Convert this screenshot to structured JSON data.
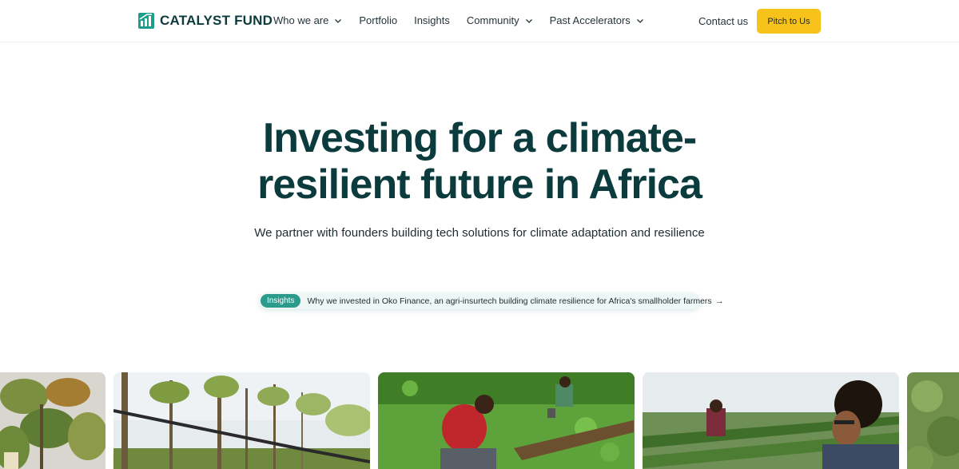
{
  "brand": {
    "name": "CATALYST FUND"
  },
  "nav": {
    "items": [
      {
        "label": "Who we are",
        "has_dropdown": true
      },
      {
        "label": "Portfolio",
        "has_dropdown": false
      },
      {
        "label": "Insights",
        "has_dropdown": false
      },
      {
        "label": "Community",
        "has_dropdown": true
      },
      {
        "label": "Past Accelerators",
        "has_dropdown": true
      }
    ],
    "contact_label": "Contact us",
    "cta_label": "Pitch to Us"
  },
  "hero": {
    "title_line1": "Investing for a climate-",
    "title_line2": "resilient future in Africa",
    "subtitle": "We partner with founders building tech solutions for climate adaptation and resilience"
  },
  "insight_pill": {
    "tag": "Insights",
    "text": "Why we invested in Oko Finance, an agri-insurtech building climate resilience for Africa's smallholder farmers",
    "arrow": "→"
  },
  "gallery": {
    "images": [
      {
        "name": "tree-leaves-photo"
      },
      {
        "name": "orchard-irrigation-photo"
      },
      {
        "name": "farmers-field-photo"
      },
      {
        "name": "greenhouse-farmer-photo"
      },
      {
        "name": "greenery-photo"
      }
    ]
  },
  "colors": {
    "brand_dark": "#0b3b3c",
    "accent_teal": "#2b9b8c",
    "cta_yellow": "#f7c21a"
  }
}
